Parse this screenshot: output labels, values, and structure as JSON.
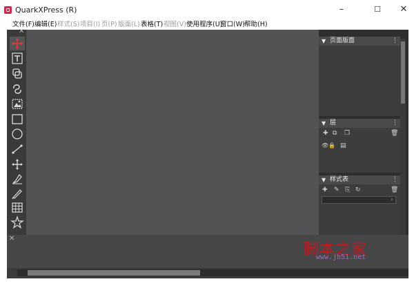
{
  "app": {
    "title": "QuarkXPress (R)",
    "logo_color": "#d9254c"
  },
  "window_controls": {
    "minimize": "–",
    "maximize": "☐",
    "close": "✕"
  },
  "menu": [
    {
      "label": "文件(F)",
      "enabled": true
    },
    {
      "label": "编辑(E)",
      "enabled": true
    },
    {
      "label": "样式(S)",
      "enabled": false
    },
    {
      "label": "项目(I)",
      "enabled": false
    },
    {
      "label": "页(P)",
      "enabled": false
    },
    {
      "label": "版面(L)",
      "enabled": false
    },
    {
      "label": "表格(T)",
      "enabled": true
    },
    {
      "label": "视图(V)",
      "enabled": false
    },
    {
      "label": "使用程序(U)",
      "enabled": true
    },
    {
      "label": "窗口(W)",
      "enabled": true
    },
    {
      "label": "帮助(H)",
      "enabled": true
    }
  ],
  "tools_palette": {
    "close_glyph": "✕",
    "tools": [
      "move-tool",
      "text-content-tool",
      "picture-content-tool",
      "linking-tool",
      "picture-box-tool",
      "rectangle-box-tool",
      "oval-box-tool",
      "line-tool",
      "pen-tool",
      "bezier-tool",
      "freehand-tool",
      "table-tool",
      "starburst-tool"
    ]
  },
  "panels": {
    "page_layout": {
      "title": "页面版面",
      "more": "⋮"
    },
    "layers": {
      "title": "层",
      "more": "⋮"
    },
    "style_sheets": {
      "title": "样式表",
      "more": "⋮"
    }
  },
  "bottom_panel": {
    "close_glyph": "✕"
  },
  "watermark": {
    "logo_text": "脚本之家",
    "url": "www.jb51.net"
  }
}
